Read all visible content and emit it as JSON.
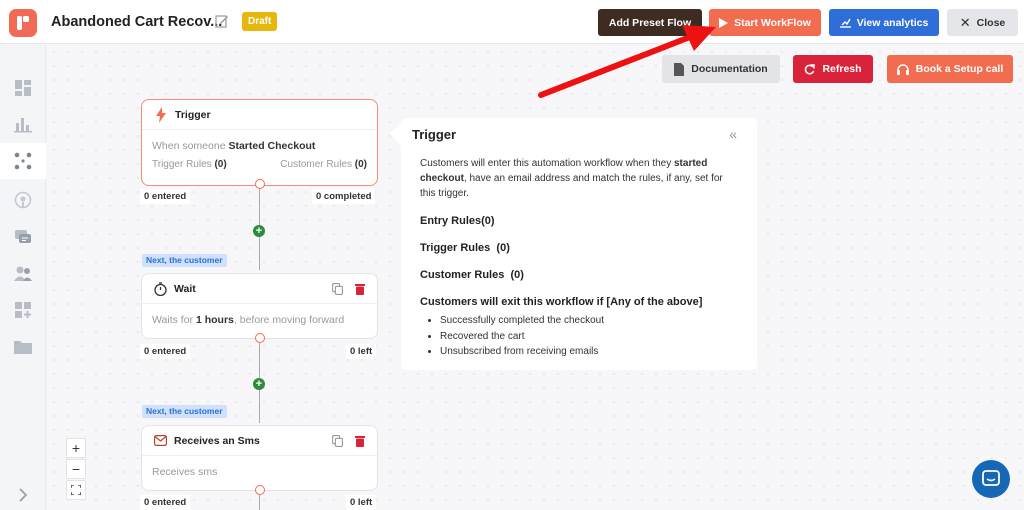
{
  "header": {
    "title": "Abandoned Cart Recov...",
    "status": "Draft",
    "buttons": {
      "add_preset": "Add Preset Flow",
      "start": "Start WorkFlow",
      "analytics": "View analytics",
      "close": "Close"
    }
  },
  "toolbar": {
    "documentation": "Documentation",
    "refresh": "Refresh",
    "setup_call": "Book a Setup call"
  },
  "sidebar": {
    "items": [
      "dashboard-icon",
      "chart-icon",
      "workflow-icon",
      "broadcast-icon",
      "chat-icon",
      "users-icon",
      "apps-icon",
      "folder-icon",
      "expand-icon"
    ]
  },
  "flow": {
    "trigger": {
      "title": "Trigger",
      "desc_prefix": "When someone",
      "desc_event": "Started Checkout",
      "trigger_rules_label": "Trigger Rules",
      "trigger_rules_count": "(0)",
      "customer_rules_label": "Customer Rules",
      "customer_rules_count": "(0)",
      "entered": "0 entered",
      "completed": "0 completed"
    },
    "chip1": "Next, the customer",
    "wait": {
      "title": "Wait",
      "desc_prefix": "Waits for",
      "duration": "1 hours",
      "desc_suffix": ", before moving forward",
      "entered": "0 entered",
      "left": "0 left"
    },
    "chip2": "Next, the customer",
    "sms": {
      "title": "Receives an Sms",
      "desc": "Receives sms",
      "entered": "0 entered",
      "left": "0 left"
    }
  },
  "panel": {
    "title": "Trigger",
    "desc_1": "Customers will enter this automation workflow when they",
    "desc_bold": "started checkout",
    "desc_2": ", have an email address and match the rules, if any, set for this trigger.",
    "entry_rules": "Entry Rules(0)",
    "trigger_rules": "Trigger Rules  (0)",
    "customer_rules": "Customer Rules  (0)",
    "exit_title": "Customers will exit this workflow if [Any of the above]",
    "exit_items": [
      "Successfully completed the checkout",
      "Recovered the cart",
      "Unsubscribed from receiving emails"
    ]
  },
  "zoom": {
    "in": "+",
    "out": "−"
  }
}
